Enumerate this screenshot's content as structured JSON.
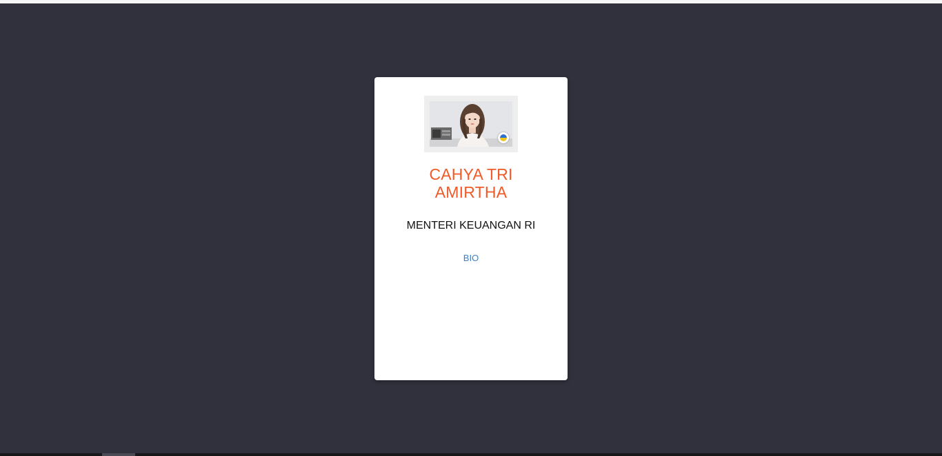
{
  "profile": {
    "name_line1": "CAHYA TRI",
    "name_line2": "AMIRTHA",
    "position": "MENTERI KEUANGAN RI",
    "bio_label": "BIO"
  },
  "colors": {
    "background": "#30313d",
    "card": "#ffffff",
    "name": "#f05a28",
    "link": "#3d7fc4",
    "badge_top": "#2f6fd0",
    "badge_bottom": "#f2c318"
  },
  "icons": {
    "badge": "status-badge-icon"
  }
}
